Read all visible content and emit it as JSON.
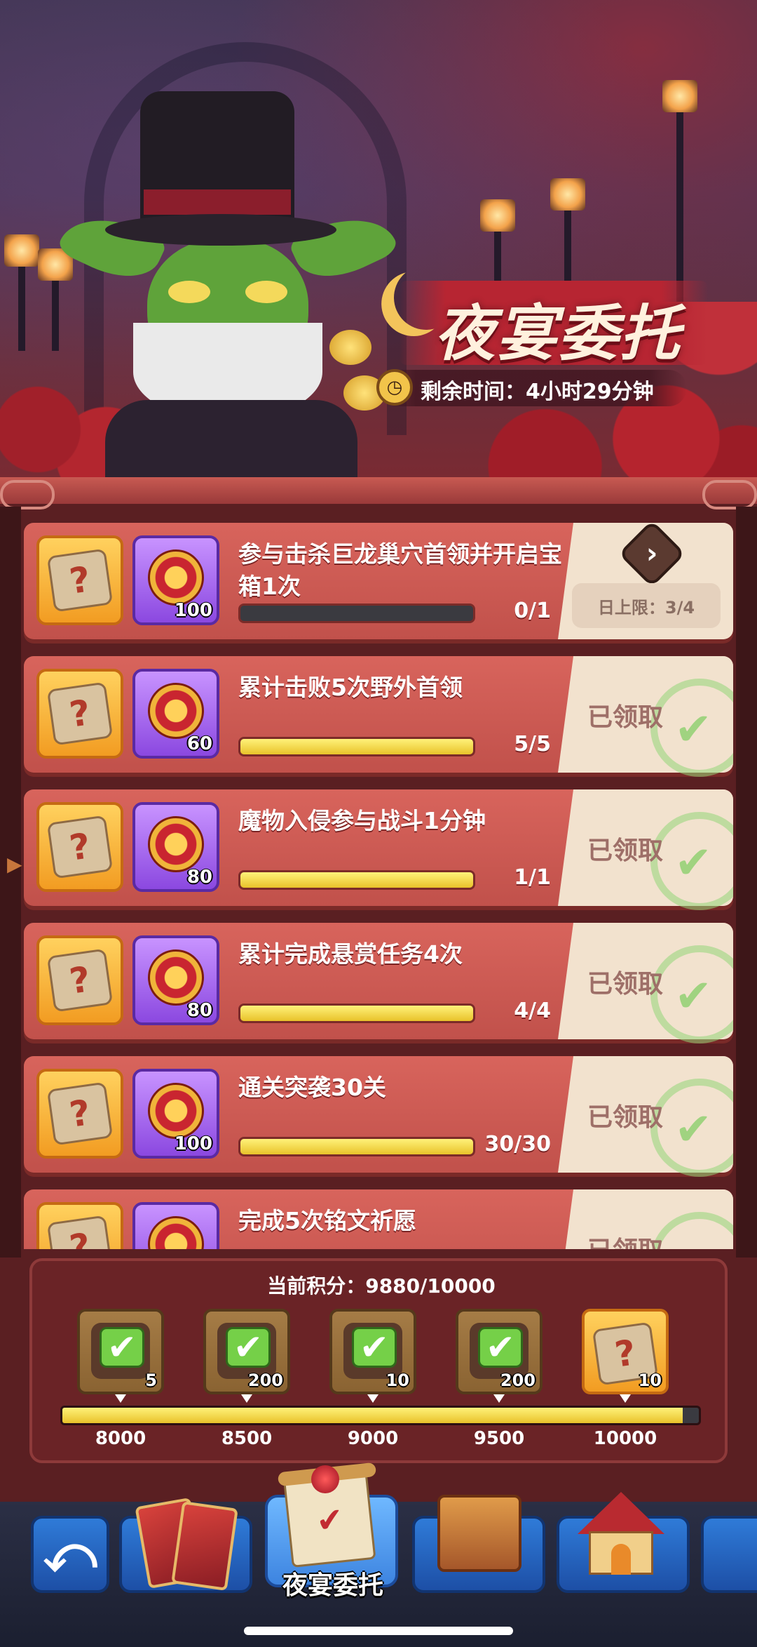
{
  "event": {
    "title": "夜宴委托",
    "timer_label": "剩余时间：",
    "timer_value": "4小时29分钟"
  },
  "tasks": [
    {
      "name": "参与击杀巨龙巢穴首领并开启宝箱1次",
      "reward_qty": "100",
      "progress": "0/1",
      "fill": 0.0,
      "status": "go",
      "daily_limit": "日上限：3/4"
    },
    {
      "name": "累计击败5次野外首领",
      "reward_qty": "60",
      "progress": "5/5",
      "fill": 1.0,
      "status": "claimed",
      "claimed_label": "已领取"
    },
    {
      "name": "魔物入侵参与战斗1分钟",
      "reward_qty": "80",
      "progress": "1/1",
      "fill": 1.0,
      "status": "claimed",
      "claimed_label": "已领取"
    },
    {
      "name": "累计完成悬赏任务4次",
      "reward_qty": "80",
      "progress": "4/4",
      "fill": 1.0,
      "status": "claimed",
      "claimed_label": "已领取"
    },
    {
      "name": "通关突袭30关",
      "reward_qty": "100",
      "progress": "30/30",
      "fill": 1.0,
      "status": "claimed",
      "claimed_label": "已领取"
    },
    {
      "name": "完成5次铭文祈愿",
      "reward_qty": "",
      "progress": "",
      "fill": 1.0,
      "status": "claimed",
      "claimed_label": "已领取"
    }
  ],
  "score": {
    "label": "当前积分：",
    "value": "9880/10000",
    "fill": 0.9752,
    "milestones": [
      {
        "threshold": "8000",
        "qty": "5",
        "claimed": true
      },
      {
        "threshold": "8500",
        "qty": "200",
        "claimed": true
      },
      {
        "threshold": "9000",
        "qty": "10",
        "claimed": true
      },
      {
        "threshold": "9500",
        "qty": "200",
        "claimed": true
      },
      {
        "threshold": "10000",
        "qty": "10",
        "claimed": false
      }
    ]
  },
  "nav": {
    "active_label": "夜宴委托",
    "tabs": [
      "back",
      "cards",
      "night-banquet-commission",
      "treasure-chest",
      "shop-house"
    ]
  },
  "glyphs": {
    "question": "?",
    "check": "✔",
    "chevron": "›",
    "back": "⤺",
    "clock": "◷"
  },
  "colors": {
    "accent_red": "#c1514b",
    "progress_yellow": "#e8c22a",
    "nav_blue": "#2f7bd8",
    "claimed_green": "#84ce66"
  }
}
